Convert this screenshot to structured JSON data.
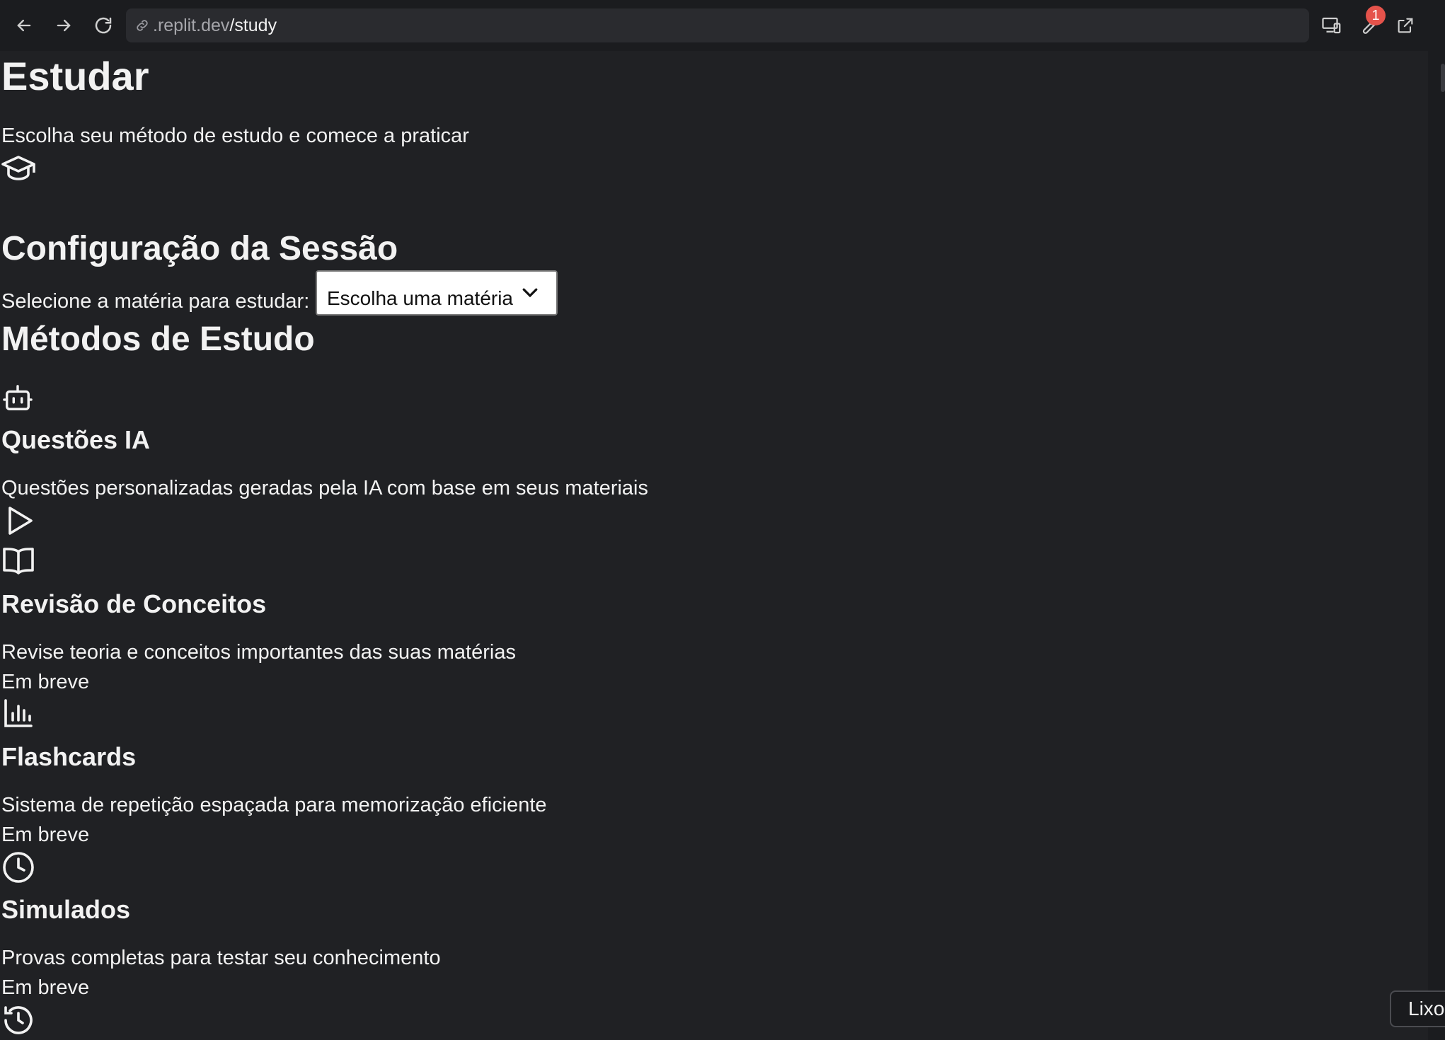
{
  "browser": {
    "url_host": ".replit.dev",
    "url_path": "/study",
    "notification_count": "1"
  },
  "page": {
    "title": "Estudar",
    "subtitle": "Escolha seu método de estudo e comece a praticar",
    "header_icon": "graduation-cap-icon"
  },
  "session": {
    "heading": "Configuração da Sessão",
    "subject_label": "Selecione a matéria para estudar:",
    "subject_placeholder": "Escolha uma matéria"
  },
  "methods": {
    "heading": "Métodos de Estudo",
    "items": [
      {
        "icon": "robot-icon",
        "title": "Questões IA",
        "description": "Questões personalizadas geradas pela IA com base em seus materiais",
        "action_icon": "play-icon",
        "status": ""
      },
      {
        "icon": "book-open-icon",
        "title": "Revisão de Conceitos",
        "description": "Revise teoria e conceitos importantes das suas matérias",
        "status": "Em breve"
      },
      {
        "icon": "bar-chart-icon",
        "title": "Flashcards",
        "description": "Sistema de repetição espaçada para memorização eficiente",
        "status": "Em breve"
      },
      {
        "icon": "clock-icon",
        "title": "Simulados",
        "description": "Provas completas para testar seu conhecimento",
        "status": "Em breve"
      }
    ],
    "trailing_icon": "history-icon"
  },
  "tooltip": {
    "text": "Lixo"
  }
}
